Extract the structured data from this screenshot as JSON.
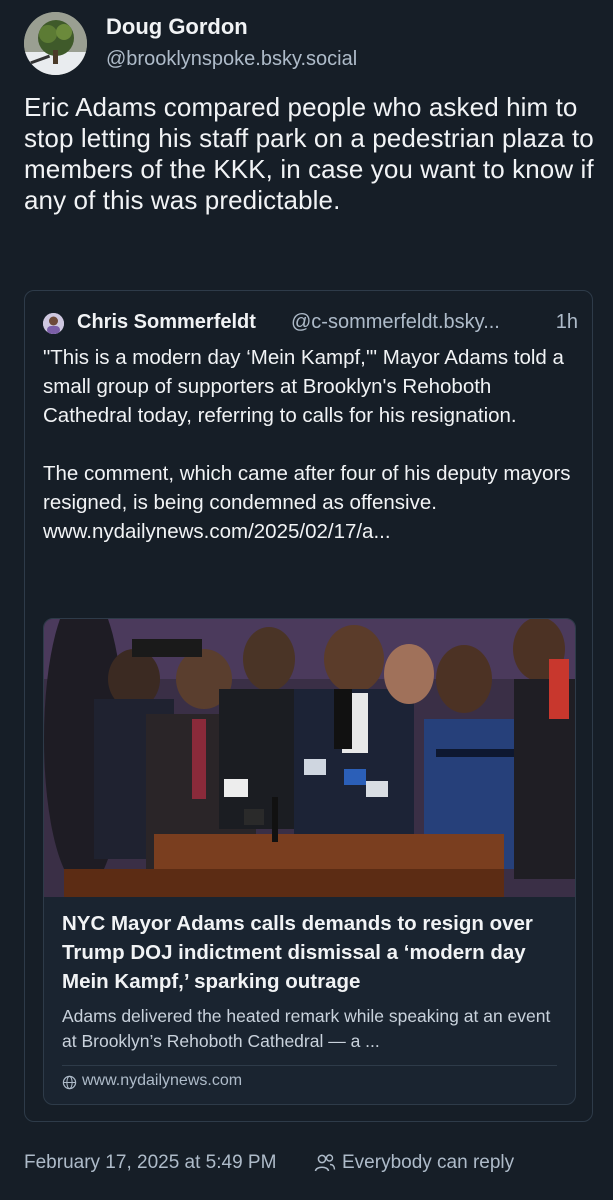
{
  "post": {
    "author": {
      "display_name": "Doug Gordon",
      "handle": "@brooklynspoke.bsky.social",
      "avatar_icon": "tree-avatar-icon"
    },
    "text": "Eric Adams compared people who asked him to stop letting his staff park on a pedestrian plaza to members of the KKK, in case you want to know if any of this was predictable.",
    "timestamp": "February 17, 2025 at 5:49 PM",
    "reply_setting": "Everybody can reply"
  },
  "quote": {
    "author": {
      "display_name": "Chris Sommerfeldt",
      "handle": "@c-sommerfeldt.bsky...",
      "avatar_icon": "person-avatar-icon"
    },
    "time": "1h",
    "text": "\"This is a modern day ‘Mein Kampf,'\" Mayor Adams told a small group of supporters at Brooklyn's Rehoboth Cathedral today, referring to calls for his resignation.\n\nThe comment, which came after four of his deputy mayors resigned, is being condemned as offensive. www.nydailynews.com/2025/02/17/a...",
    "link_card": {
      "image_description_icon": "press-conference-photo",
      "title": "NYC Mayor Adams calls demands to resign over Trump DOJ indictment dismissal a ‘modern day Mein Kampf,’ sparking outrage",
      "description": "Adams delivered the heated remark while speaking at an event at Brooklyn’s Rehoboth Cathedral — a ...",
      "domain": "www.nydailynews.com"
    }
  },
  "colors": {
    "background": "#161e27",
    "text": "#f1f3f5",
    "muted": "#aebbc9",
    "border": "#2e3b49"
  }
}
